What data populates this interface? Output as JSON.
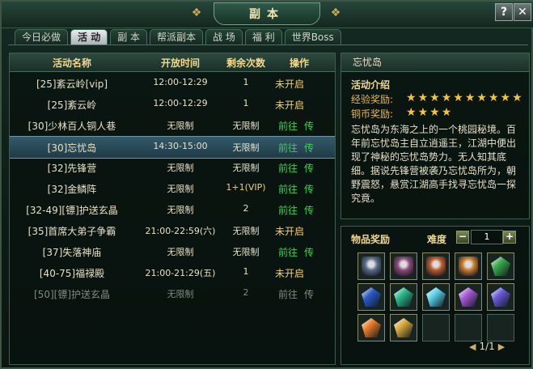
{
  "window": {
    "title": "副本",
    "help_icon": "?",
    "close_icon": "✕"
  },
  "tabs": [
    {
      "label": "今日必做",
      "active": false
    },
    {
      "label": "活 动",
      "active": true
    },
    {
      "label": "副 本",
      "active": false
    },
    {
      "label": "帮派副本",
      "active": false
    },
    {
      "label": "战 场",
      "active": false
    },
    {
      "label": "福 利",
      "active": false
    },
    {
      "label": "世界Boss",
      "active": false
    }
  ],
  "table": {
    "headers": {
      "name": "活动名称",
      "time": "开放时间",
      "remaining": "剩余次数",
      "action": "操作"
    },
    "rows": [
      {
        "name": "[25]紊云岭[vip]",
        "time": "12:00-12:29",
        "remaining": "1",
        "action": "未开启",
        "teleport": ""
      },
      {
        "name": "[25]紊云岭",
        "time": "12:00-12:29",
        "remaining": "1",
        "action": "未开启",
        "teleport": ""
      },
      {
        "name": "[30]少林百人铜人巷",
        "time": "无限制",
        "remaining": "无限制",
        "action": "前往",
        "teleport": "传"
      },
      {
        "name": "[30]忘忧岛",
        "time": "14:30-15:00",
        "remaining": "无限制",
        "action": "前往",
        "teleport": "传"
      },
      {
        "name": "[32]先锋营",
        "time": "无限制",
        "remaining": "无限制",
        "action": "前往",
        "teleport": "传"
      },
      {
        "name": "[32]金鳞阵",
        "time": "无限制",
        "remaining": "1+1(VIP)",
        "action": "前往",
        "teleport": "传"
      },
      {
        "name": "[32-49][镖]护送玄晶",
        "time": "无限制",
        "remaining": "2",
        "action": "前往",
        "teleport": "传"
      },
      {
        "name": "[35]首席大弟子争霸",
        "time": "21:00-22:59(六)",
        "remaining": "无限制",
        "action": "未开启",
        "teleport": ""
      },
      {
        "name": "[37]失落神庙",
        "time": "无限制",
        "remaining": "无限制",
        "action": "前往",
        "teleport": "传"
      },
      {
        "name": "[40-75]福禄殿",
        "time": "21:00-21:29(五)",
        "remaining": "1",
        "action": "未开启",
        "teleport": ""
      },
      {
        "name": "[50][镖]护送玄晶",
        "time": "无限制",
        "remaining": "2",
        "action": "前往",
        "teleport": "传"
      }
    ],
    "selected_index": 3,
    "disabled_index": 10
  },
  "detail": {
    "header": "忘忧岛",
    "intro_title": "活动介绍",
    "exp_label": "经验奖励:",
    "exp_stars": 10,
    "coin_label": "铜币奖励:",
    "coin_stars": 4,
    "description": "忘忧岛为东海之上的一个桃园秘境。百年前忘忧岛主自立逍遥王，江湖中便出现了神秘的忘忧岛势力。无人知其底细。据说先锋营被袭乃忘忧岛所为，朝野震怒，悬赏江湖高手找寻忘忧岛一探究竟。"
  },
  "rewards": {
    "title": "物品奖励",
    "difficulty_label": "难度",
    "difficulty_value": "1",
    "minus_label": "−",
    "plus_label": "+",
    "page_text": "1/1",
    "items": [
      {
        "icon": "armor-icon",
        "color": "#5a6a88"
      },
      {
        "icon": "armor-icon",
        "color": "#8a4a7a"
      },
      {
        "icon": "armor-icon",
        "color": "#b85a2a"
      },
      {
        "icon": "armor-icon",
        "color": "#c87a2a"
      },
      {
        "icon": "green-gem-icon",
        "color": "#3aa84a"
      },
      {
        "icon": "blue-gem-icon",
        "color": "#2a5ac8"
      },
      {
        "icon": "teal-gem-icon",
        "color": "#2ab88a"
      },
      {
        "icon": "cyan-gem-icon",
        "color": "#5ad0e8"
      },
      {
        "icon": "purple-gem-icon",
        "color": "#a85ad8"
      },
      {
        "icon": "violet-gem-icon",
        "color": "#6a5ad8"
      },
      {
        "icon": "orange-gem-icon",
        "color": "#e87a2a"
      },
      {
        "icon": "gold-scroll-icon",
        "color": "#d8a83a"
      },
      {
        "icon": "",
        "color": ""
      },
      {
        "icon": "",
        "color": ""
      },
      {
        "icon": "",
        "color": ""
      }
    ]
  }
}
